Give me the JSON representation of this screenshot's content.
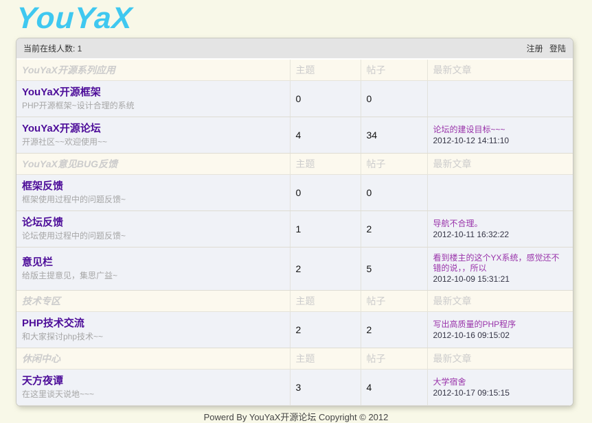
{
  "logo": {
    "text": "YouYaX"
  },
  "topbar": {
    "online_text": "当前在线人数: 1",
    "register_label": "注册",
    "login_label": "登陆"
  },
  "board": {
    "columns": {
      "topics": "主题",
      "posts": "帖子",
      "latest": "最新文章"
    },
    "categories": [
      {
        "title": "YouYaX开源系列应用",
        "forums": [
          {
            "name": "YouYaX开源框架",
            "desc": "PHP开源框架~设计合理的系统",
            "topics": "0",
            "posts": "0",
            "latest_title": "",
            "latest_date": ""
          },
          {
            "name": "YouYaX开源论坛",
            "desc": "开源社区~~欢迎使用~~",
            "topics": "4",
            "posts": "34",
            "latest_title": "论坛的建设目标~~~",
            "latest_date": "2012-10-12 14:11:10"
          }
        ]
      },
      {
        "title": "YouYaX意见BUG反馈",
        "forums": [
          {
            "name": "框架反馈",
            "desc": "框架使用过程中的问题反馈~",
            "topics": "0",
            "posts": "0",
            "latest_title": "",
            "latest_date": ""
          },
          {
            "name": "论坛反馈",
            "desc": "论坛使用过程中的问题反馈~",
            "topics": "1",
            "posts": "2",
            "latest_title": "导航不合理。",
            "latest_date": "2012-10-11 16:32:22"
          },
          {
            "name": "意见栏",
            "desc": "给版主提意见，集思广益~",
            "topics": "2",
            "posts": "5",
            "latest_title": "看到楼主的这个YX系统，感觉还不错的说，，所以",
            "latest_date": "2012-10-09 15:31:21"
          }
        ]
      },
      {
        "title": "技术专区",
        "forums": [
          {
            "name": "PHP技术交流",
            "desc": "和大家探讨php技术~~",
            "topics": "2",
            "posts": "2",
            "latest_title": "写出高质量的PHP程序",
            "latest_date": "2012-10-16 09:15:02"
          }
        ]
      },
      {
        "title": "休闲中心",
        "forums": [
          {
            "name": "天方夜谭",
            "desc": "在这里谈天说地~~~",
            "topics": "3",
            "posts": "4",
            "latest_title": "大学宿舍",
            "latest_date": "2012-10-17 09:15:15"
          }
        ]
      }
    ]
  },
  "footer": {
    "text": "Powerd By YouYaX开源论坛 Copyright © 2012"
  },
  "colors": {
    "logo": "#3fc8f0",
    "forum_link": "#4d0d99",
    "latest_link": "#9933aa",
    "page_background": "#f8f8e8",
    "topbar_background": "#e4e4e4",
    "category_row_background": "#fcf9ee",
    "forum_row_background": "#f0f2f7"
  }
}
